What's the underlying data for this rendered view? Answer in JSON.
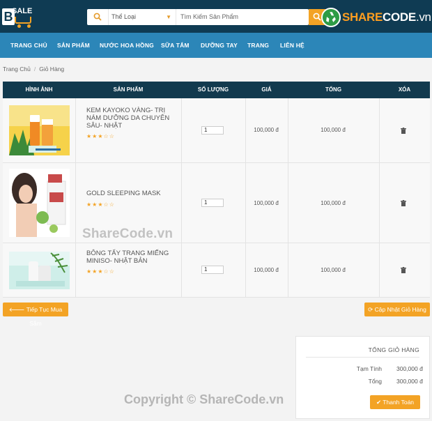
{
  "header": {
    "logo_letter": "B",
    "logo_text": "SALE",
    "search_category": "Thể Loại",
    "search_placeholder": "Tìm Kiếm Sản Phẩm",
    "watermark_brand": {
      "part1": "SHARE",
      "part2": "CODE",
      "part3": ".vn"
    }
  },
  "nav": {
    "items": [
      "TRANG CHỦ",
      "SẢN PHẨM",
      "NƯỚC HOA HỒNG",
      "SỮA TẮM",
      "DƯỠNG TAY",
      "TRANG",
      "LIÊN HỆ"
    ]
  },
  "breadcrumb": {
    "home": "Trang Chủ",
    "current": "Giỏ Hàng"
  },
  "table": {
    "headers": [
      "HÌNH ẢNH",
      "SẢN PHẨM",
      "SỐ LƯỢNG",
      "GIÁ",
      "TỔNG",
      "XÓA"
    ],
    "rows": [
      {
        "name": "KEM KAYOKO VÀNG- TRỊ NÁM DƯỠNG DA CHUYÊN SÂU- NHẬT",
        "stars": "★★★☆☆",
        "qty": "1",
        "price": "100,000 đ",
        "total": "100,000 đ"
      },
      {
        "name": "GOLD SLEEPING MASK",
        "stars": "★★★☆☆",
        "qty": "1",
        "price": "100,000 đ",
        "total": "100,000 đ"
      },
      {
        "name": "BÔNG TẨY TRANG MIẾNG MINISO- NHẬT BẢN",
        "stars": "★★★☆☆",
        "qty": "1",
        "price": "100,000 đ",
        "total": "100,000 đ"
      }
    ]
  },
  "buttons": {
    "continue": "Tiếp Tục Mua Sắm",
    "update": "Cập Nhật Giỏ Hàng",
    "checkout": "Thanh Toán"
  },
  "totals": {
    "title": "TỔNG GIỎ HÀNG",
    "subtotal_label": "Tạm Tính",
    "subtotal_value": "300,000 đ",
    "total_label": "Tổng",
    "total_value": "300,000 đ"
  },
  "watermarks": {
    "middle": "ShareCode.vn",
    "bottom": "Copyright © ShareCode.vn"
  },
  "colors": {
    "accent": "#f3a325",
    "nav": "#2c86b8",
    "topbar": "#0f3b53",
    "table_head": "#123a4e"
  }
}
